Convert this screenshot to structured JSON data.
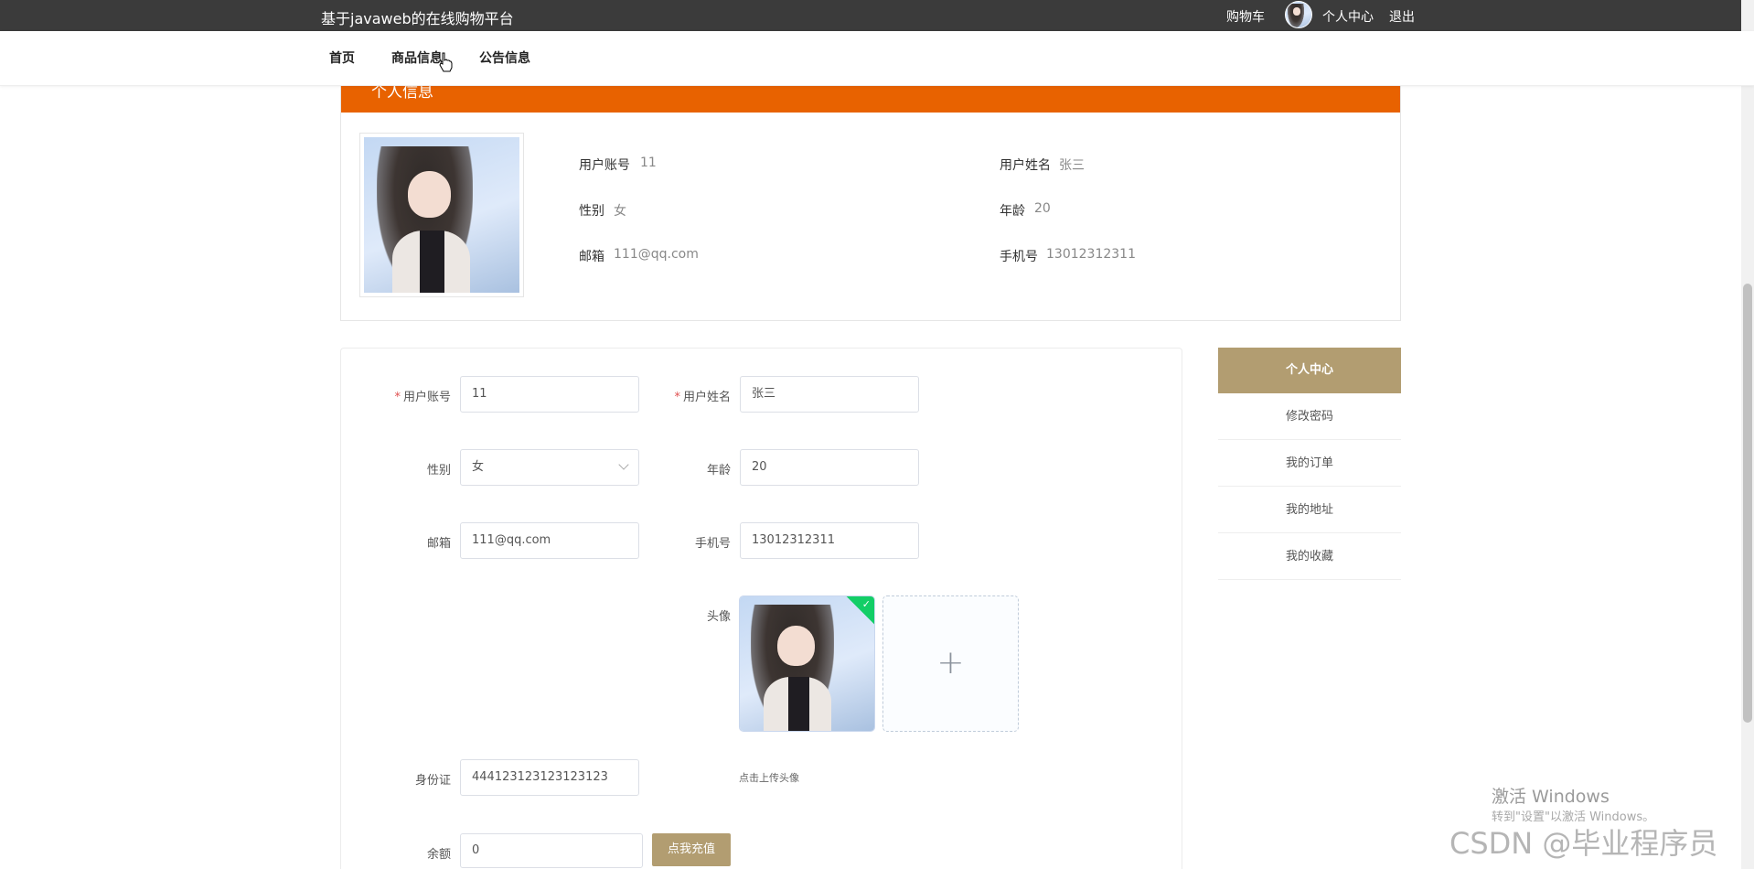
{
  "topbar": {
    "title": "基于javaweb的在线购物平台",
    "cart": "购物车",
    "personal_center": "个人中心",
    "logout": "退出"
  },
  "nav": {
    "items": [
      "首页",
      "商品信息",
      "公告信息"
    ]
  },
  "profile": {
    "header": "个人信息",
    "account_label": "用户账号",
    "account_value": "11",
    "name_label": "用户姓名",
    "name_value": "张三",
    "gender_label": "性别",
    "gender_value": "女",
    "age_label": "年龄",
    "age_value": "20",
    "email_label": "邮箱",
    "email_value": "111@qq.com",
    "phone_label": "手机号",
    "phone_value": "13012312311"
  },
  "form": {
    "account_label": "用户账号",
    "account_value": "11",
    "name_label": "用户姓名",
    "name_value": "张三",
    "gender_label": "性别",
    "gender_value": "女",
    "age_label": "年龄",
    "age_value": "20",
    "email_label": "邮箱",
    "email_value": "111@qq.com",
    "phone_label": "手机号",
    "phone_value": "13012312311",
    "avatar_label": "头像",
    "upload_plus": "+",
    "upload_tip": "点击上传头像",
    "idcard_label": "身份证",
    "idcard_value": "444123123123123123",
    "balance_label": "余额",
    "balance_value": "0",
    "recharge_button": "点我充值",
    "required_mark": "*"
  },
  "side_menu": {
    "head": "个人中心",
    "items": [
      "修改密码",
      "我的订单",
      "我的地址",
      "我的收藏"
    ]
  },
  "watermarks": {
    "windows_title": "激活 Windows",
    "windows_sub": "转到\"设置\"以激活 Windows。",
    "csdn": "CSDN @毕业程序员"
  },
  "colors": {
    "topbar": "#3b3b3b",
    "profile_header": "#e86200",
    "accent": "#b29d71",
    "upload_success": "#13ce66"
  }
}
